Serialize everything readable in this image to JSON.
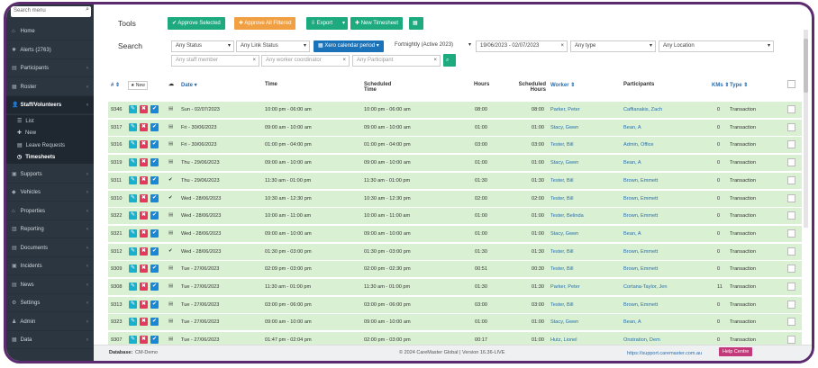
{
  "sidebar": {
    "search_placeholder": "Search menu",
    "items": [
      {
        "label": "Home"
      },
      {
        "label": "Alerts (2763)"
      },
      {
        "label": "Participants"
      },
      {
        "label": "Roster"
      },
      {
        "label": "Staff/Volunteers"
      },
      {
        "label": "Supports"
      },
      {
        "label": "Vehicles"
      },
      {
        "label": "Properties"
      },
      {
        "label": "Reporting"
      },
      {
        "label": "Documents"
      },
      {
        "label": "Incidents"
      },
      {
        "label": "News"
      },
      {
        "label": "Settings"
      },
      {
        "label": "Admin"
      },
      {
        "label": "Data"
      }
    ],
    "subitems": [
      {
        "label": "List"
      },
      {
        "label": "New"
      },
      {
        "label": "Leave Requests"
      },
      {
        "label": "Timesheets"
      }
    ]
  },
  "tools": {
    "label": "Tools",
    "approve_selected": "Approve Selected",
    "approve_all": "Approve All Filtered",
    "export": "Export",
    "new_timesheet": "New Timesheet"
  },
  "search": {
    "label": "Search",
    "status": "Any Status",
    "link_status": "Any Link Status",
    "xero": "Xero calendar period",
    "period": "Fortnightly (Active 2023)",
    "range": "19/06/2023 - 02/07/2023",
    "type": "Any type",
    "location": "Any Location",
    "staff_ph": "Any staff member",
    "coord_ph": "Any worker coordinator",
    "participant_ph": "Any Participant"
  },
  "columns": {
    "id": "# ⇕",
    "new": "★ New",
    "date": "Date ▾",
    "time": "Time",
    "scheduled_time": "Scheduled Time",
    "hours": "Hours",
    "scheduled_hours": "Scheduled Hours",
    "worker": "Worker ⇕",
    "participants": "Participants",
    "kms": "KMs ⇕",
    "type": "Type ⇕"
  },
  "rows": [
    {
      "id": "9346",
      "date": "Sun - 02/07/2023",
      "time": "10:00 pm - 06:00 am",
      "sched": "10:00 pm - 06:00 am",
      "hours": "08:00",
      "shours": "08:00",
      "worker": "Parker, Peter",
      "part": "Caffianakis, Zach",
      "kms": "0",
      "type": "Transaction",
      "check": false
    },
    {
      "id": "9317",
      "date": "Fri - 30/06/2023",
      "time": "09:00 am - 10:00 am",
      "sched": "09:00 am - 10:00 am",
      "hours": "01:00",
      "shours": "01:00",
      "worker": "Stacy, Gwen",
      "part": "Bean, A",
      "kms": "0",
      "type": "Transaction",
      "check": false
    },
    {
      "id": "9316",
      "date": "Fri - 30/06/2023",
      "time": "01:00 pm - 04:00 pm",
      "sched": "01:00 pm - 04:00 pm",
      "hours": "03:00",
      "shours": "03:00",
      "worker": "Tester, Bill",
      "part": "Admin, Office",
      "kms": "0",
      "type": "Transaction",
      "check": false
    },
    {
      "id": "9319",
      "date": "Thu - 29/06/2023",
      "time": "09:00 am - 10:00 am",
      "sched": "09:00 am - 10:00 am",
      "hours": "01:00",
      "shours": "01:00",
      "worker": "Stacy, Gwen",
      "part": "Bean, A",
      "kms": "0",
      "type": "Transaction",
      "check": false
    },
    {
      "id": "9311",
      "date": "Thu - 29/06/2023",
      "time": "11:30 am - 01:00 pm",
      "sched": "11:30 am - 01:00 pm",
      "hours": "01:30",
      "shours": "01:30",
      "worker": "Tester, Bill",
      "part": "Brown, Emmett",
      "kms": "0",
      "type": "Transaction",
      "check": true
    },
    {
      "id": "9310",
      "date": "Wed - 28/06/2023",
      "time": "10:30 am - 12:30 pm",
      "sched": "10:30 am - 12:30 pm",
      "hours": "02:00",
      "shours": "02:00",
      "worker": "Tester, Bill",
      "part": "Brown, Emmett",
      "kms": "0",
      "type": "Transaction",
      "check": true
    },
    {
      "id": "9322",
      "date": "Wed - 28/06/2023",
      "time": "10:00 am - 11:00 am",
      "sched": "10:00 am - 11:00 am",
      "hours": "01:00",
      "shours": "01:00",
      "worker": "Tester, Belinda",
      "part": "Brown, Emmett",
      "kms": "0",
      "type": "Transaction",
      "check": false
    },
    {
      "id": "9321",
      "date": "Wed - 28/06/2023",
      "time": "09:00 am - 10:00 am",
      "sched": "09:00 am - 10:00 am",
      "hours": "01:00",
      "shours": "01:00",
      "worker": "Stacy, Gwen",
      "part": "Bean, A",
      "kms": "0",
      "type": "Transaction",
      "check": false
    },
    {
      "id": "9312",
      "date": "Wed - 28/06/2023",
      "time": "01:30 pm - 03:00 pm",
      "sched": "01:30 pm - 03:00 pm",
      "hours": "01:30",
      "shours": "01:30",
      "worker": "Tester, Bill",
      "part": "Brown, Emmett",
      "kms": "0",
      "type": "Transaction",
      "check": true
    },
    {
      "id": "9309",
      "date": "Tue - 27/06/2023",
      "time": "02:09 pm - 03:00 pm",
      "sched": "02:00 pm - 02:30 pm",
      "hours": "00:51",
      "shours": "00:30",
      "worker": "Tester, Bill",
      "part": "Brown, Emmett",
      "kms": "0",
      "type": "Transaction",
      "check": false
    },
    {
      "id": "9308",
      "date": "Tue - 27/06/2023",
      "time": "11:30 am - 01:00 pm",
      "sched": "11:30 am - 01:00 pm",
      "hours": "01:30",
      "shours": "01:30",
      "worker": "Parker, Peter",
      "part": "Cortana-Taylor, Jen",
      "kms": "11",
      "type": "Transaction",
      "check": false
    },
    {
      "id": "9313",
      "date": "Tue - 27/06/2023",
      "time": "03:00 pm - 06:00 pm",
      "sched": "03:00 pm - 06:00 pm",
      "hours": "03:00",
      "shours": "03:00",
      "worker": "Tester, Bill",
      "part": "Brown, Emmett",
      "kms": "0",
      "type": "Transaction",
      "check": false
    },
    {
      "id": "9323",
      "date": "Tue - 27/06/2023",
      "time": "09:00 am - 10:00 am",
      "sched": "09:00 am - 10:00 am",
      "hours": "01:00",
      "shours": "01:00",
      "worker": "Stacy, Gwen",
      "part": "Bean, A",
      "kms": "0",
      "type": "Transaction",
      "check": false
    },
    {
      "id": "9307",
      "date": "Tue - 27/06/2023",
      "time": "01:47 pm - 02:04 pm",
      "sched": "02:00 pm - 03:00 pm",
      "hours": "00:17",
      "shours": "01:00",
      "worker": "Hutz, Lionel",
      "part": "Onstration, Dem",
      "kms": "0",
      "type": "Transaction",
      "check": false
    }
  ],
  "footer": {
    "db_label": "Database:",
    "db_value": "CM-Demo",
    "copyright": "© 2024 CareMaster Global | Version 16.36-LIVE",
    "support": "https://support.caremaster.com.au",
    "help": "Help Centre"
  },
  "colors": {
    "row_green": "#d9f0d3",
    "approve_selected": "#1eaa7f",
    "approve_all": "#f0a042",
    "export": "#1eaa7f",
    "new_timesheet": "#1eaa7f",
    "xero": "#1a73b8",
    "edit_action": "#19b0cd",
    "delete_action": "#e2395d",
    "check_action": "#1a86d4",
    "help": "#c23a7a",
    "frame": "#5c2a6f"
  }
}
